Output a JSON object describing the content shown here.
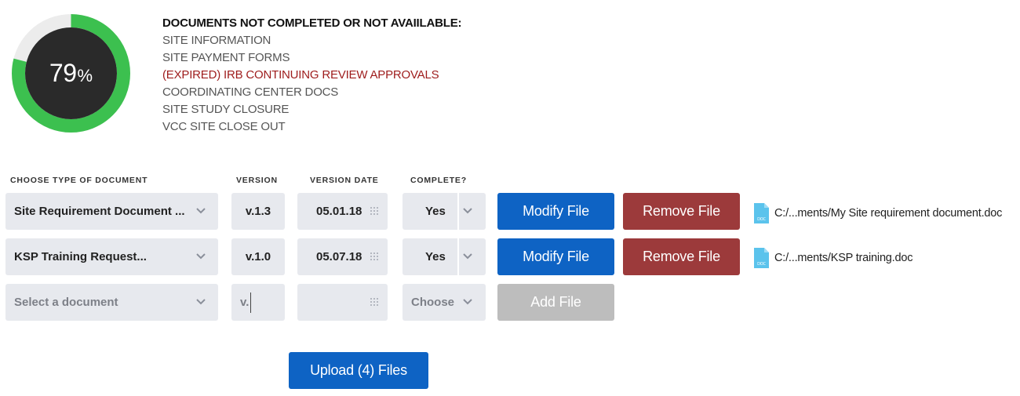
{
  "progress": {
    "value": 79,
    "number": "79",
    "unit": "%",
    "fill_color": "#3cc04f",
    "track_color": "#ececec",
    "center_color": "#2a2a2a"
  },
  "missing": {
    "title": "DOCUMENTS NOT COMPLETED OR NOT AVAIILABLE:",
    "items": [
      "SITE INFORMATION",
      "SITE PAYMENT FORMS",
      "(EXPIRED) IRB CONTINUING REVIEW APPROVALS",
      "COORDINATING CENTER DOCS",
      "SITE STUDY CLOSURE",
      "VCC SITE CLOSE OUT"
    ]
  },
  "headers": {
    "type": "CHOOSE TYPE OF DOCUMENT",
    "version": "VERSION",
    "date": "VERSION DATE",
    "complete": "COMPLETE?"
  },
  "rows": [
    {
      "type": "Site Requirement Document ...",
      "version": "v.1.3",
      "date": "05.01.18",
      "complete": "Yes",
      "modify": "Modify File",
      "remove": "Remove File",
      "file": "C:/...ments/My Site requirement document.doc"
    },
    {
      "type": "KSP Training Request...",
      "version": "v.1.0",
      "date": "05.07.18",
      "complete": "Yes",
      "modify": "Modify File",
      "remove": "Remove File",
      "file": "C:/...ments/KSP training.doc"
    }
  ],
  "new_row": {
    "type_placeholder": "Select a document",
    "version_placeholder": "v.",
    "complete_placeholder": "Choose",
    "add": "Add File"
  },
  "upload": {
    "label": "Upload (4) Files"
  },
  "icons": {
    "chevron": "chevron-down-icon",
    "date_picker": "grid-dots-icon",
    "doc": "doc-file-icon"
  }
}
